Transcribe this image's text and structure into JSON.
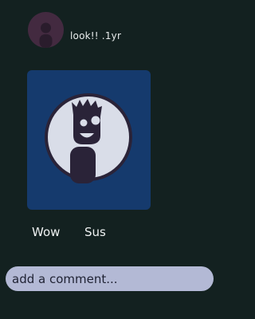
{
  "post": {
    "caption": "look!! .1yr",
    "avatar_icon": "person-silhouette-icon",
    "image_icon": "smiling-cartoon-figure-icon"
  },
  "reactions": [
    {
      "label": "Wow"
    },
    {
      "label": "Sus"
    }
  ],
  "comment": {
    "placeholder": "add a comment...",
    "value": ""
  },
  "colors": {
    "background": "#132120",
    "avatar_bg": "#432a40",
    "image_bg": "#153a6d",
    "comment_bg": "#b3b9d5",
    "text": "#e8ecec"
  }
}
